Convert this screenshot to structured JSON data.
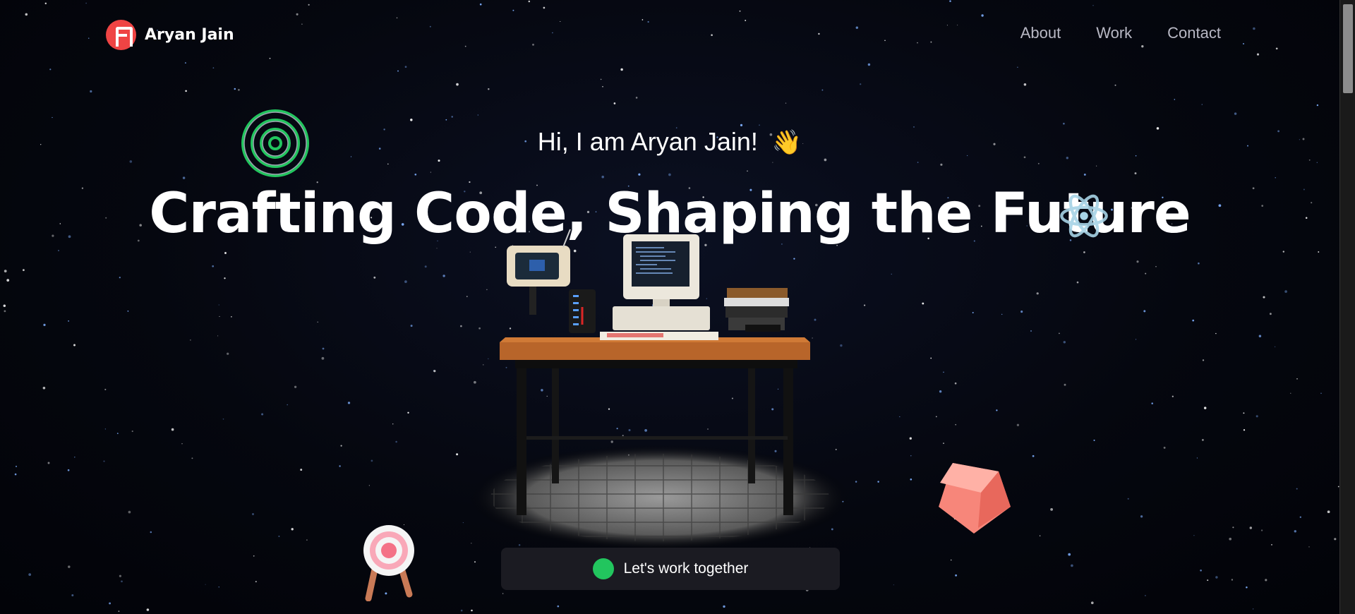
{
  "brand": {
    "name": "Aryan Jain",
    "logo_icon": "a-letter-logo-icon",
    "logo_color": "#ef4444"
  },
  "nav": {
    "links": [
      {
        "label": "About"
      },
      {
        "label": "Work"
      },
      {
        "label": "Contact"
      }
    ]
  },
  "hero": {
    "greeting": "Hi, I am Aryan Jain!",
    "greeting_emoji": "👋",
    "headline": "Crafting Code, Shaping the Future"
  },
  "cta": {
    "label": "Let's work together",
    "dot_color": "#22c55e"
  },
  "decorations": [
    "concentric-rings-icon",
    "react-atom-icon",
    "archery-target-icon",
    "pink-cube-icon",
    "retro-desk-illustration"
  ],
  "colors": {
    "background": "#05070f",
    "accent": "#ef4444",
    "nav_text": "#b8b8c4",
    "cta_bg": "#1b1b22"
  }
}
